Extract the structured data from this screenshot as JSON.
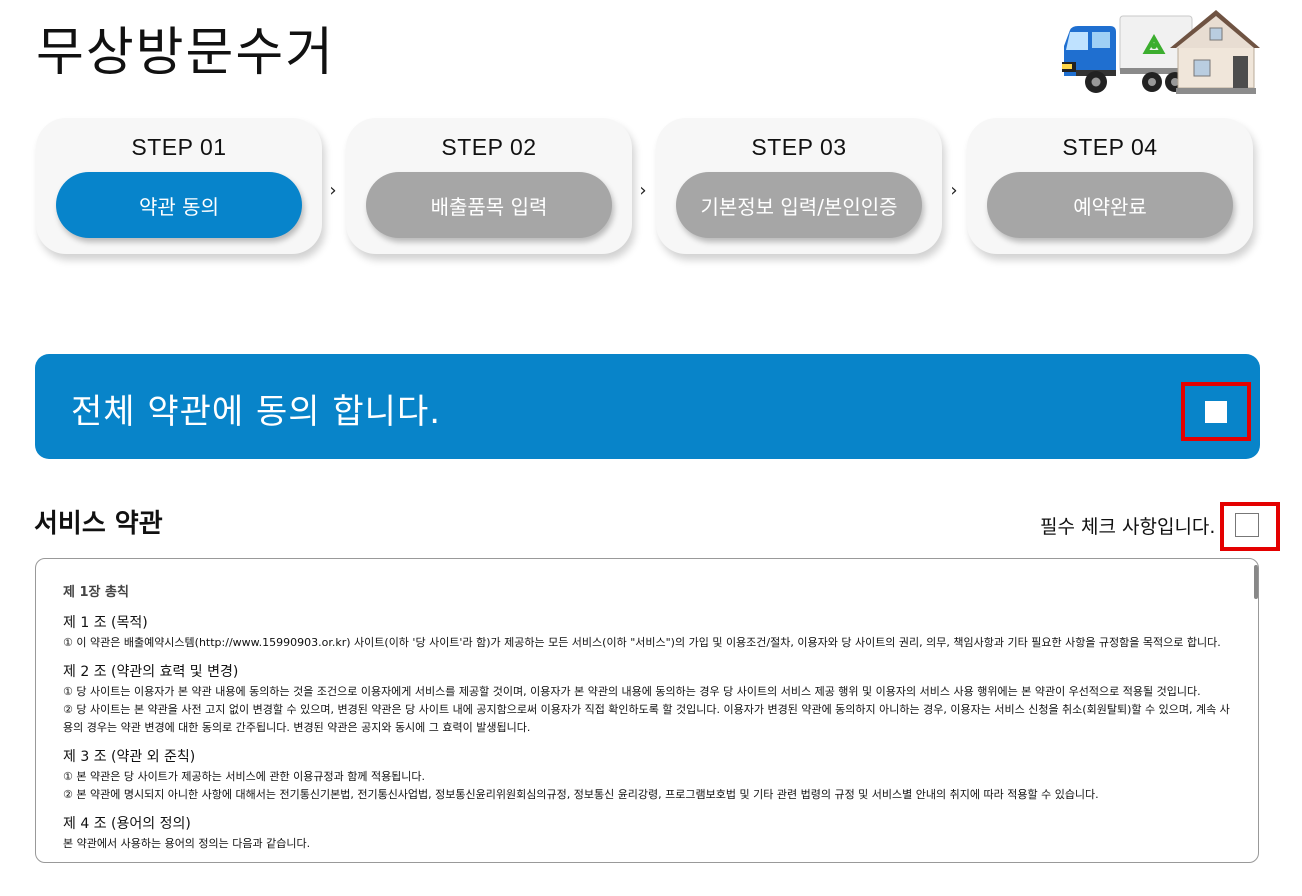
{
  "page": {
    "title": "무상방문수거"
  },
  "hero": {
    "icons": [
      "truck-icon",
      "recycle-icon",
      "house-icon"
    ]
  },
  "steps": [
    {
      "label": "STEP 01",
      "button": "약관 동의",
      "active": true
    },
    {
      "label": "STEP 02",
      "button": "배출품목 입력",
      "active": false
    },
    {
      "label": "STEP 03",
      "button": "기본정보 입력/본인인증",
      "active": false
    },
    {
      "label": "STEP 04",
      "button": "예약완료",
      "active": false
    }
  ],
  "step_arrow": "›",
  "agree_all": {
    "text": "전체 약관에 동의 합니다.",
    "checked": false
  },
  "service_terms": {
    "title": "서비스 약관",
    "required_label": "필수 체크 사항입니다.",
    "checked": false
  },
  "terms": {
    "chapter": "제 1장 총칙",
    "articles": [
      {
        "title": "제 1 조 (목적)",
        "paragraphs": [
          "① 이 약관은 배출예약시스템(http://www.15990903.or.kr) 사이트(이하 '당 사이트'라 함)가 제공하는 모든 서비스(이하 \"서비스\")의 가입 및 이용조건/절차, 이용자와 당 사이트의 권리, 의무, 책임사항과 기타 필요한 사항을 규정함을 목적으로 합니다."
        ]
      },
      {
        "title": "제 2 조 (약관의 효력 및 변경)",
        "paragraphs": [
          "① 당 사이트는 이용자가 본 약관 내용에 동의하는 것을 조건으로 이용자에게 서비스를 제공할 것이며, 이용자가 본 약관의 내용에 동의하는 경우 당 사이트의 서비스 제공 행위 및 이용자의 서비스 사용 행위에는 본 약관이 우선적으로 적용될 것입니다.",
          "② 당 사이트는 본 약관을 사전 고지 없이 변경할 수 있으며, 변경된 약관은 당 사이트 내에 공지함으로써 이용자가 직접 확인하도록 할 것입니다. 이용자가 변경된 약관에 동의하지 아니하는 경우, 이용자는 서비스 신청을 취소(회원탈퇴)할 수 있으며, 계속 사용의 경우는 약관 변경에 대한 동의로 간주됩니다. 변경된 약관은 공지와 동시에 그 효력이 발생됩니다."
        ]
      },
      {
        "title": "제 3 조 (약관 외 준칙)",
        "paragraphs": [
          "① 본 약관은 당 사이트가 제공하는 서비스에 관한 이용규정과 함께 적용됩니다.",
          "② 본 약관에 명시되지 아니한 사항에 대해서는 전기통신기본법, 전기통신사업법, 정보통신윤리위원회심의규정, 정보통신 윤리강령, 프로그램보호법 및 기타 관련 법령의 규정 및 서비스별 안내의 취지에 따라 적용할 수 있습니다."
        ]
      },
      {
        "title": "제 4 조 (용어의 정의)",
        "paragraphs": [
          "본 약관에서 사용하는 용어의 정의는 다음과 같습니다."
        ]
      }
    ]
  }
}
